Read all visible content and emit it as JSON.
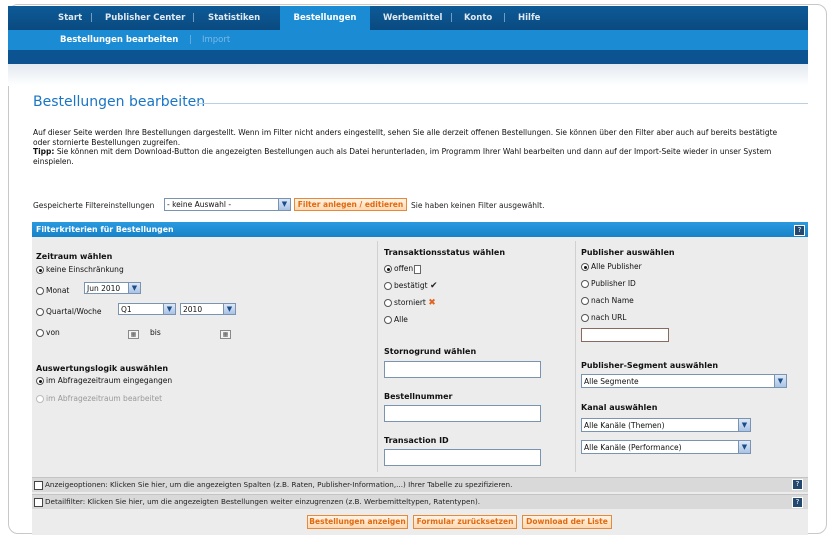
{
  "nav": {
    "items": [
      "Start",
      "Publisher Center",
      "Statistiken",
      "Bestellungen",
      "Werbemittel",
      "Konto",
      "Hilfe"
    ],
    "separator": "|",
    "sub_active": "Bestellungen bearbeiten",
    "sub_separator": "|",
    "sub_inactive": "Import"
  },
  "page": {
    "title": "Bestellungen bearbeiten",
    "intro_line1": "Auf dieser Seite werden Ihre Bestellungen dargestellt. Wenn im Filter nicht anders eingestellt, sehen Sie alle derzeit offenen Bestellungen. Sie können über den Filter aber auch auf bereits bestätigte oder stornierte Bestellungen zugreifen.",
    "tip_label": "Tipp:",
    "tip_text": " Sie können mit dem Download-Button die angezeigten Bestellungen auch als Datei herunterladen, im Programm Ihrer Wahl bearbeiten und dann auf der Import-Seite wieder in unser System einspielen."
  },
  "saved_filters": {
    "label": "Gespeicherte Filtereinstellungen",
    "selected": "- keine Auswahl -",
    "button": "Filter anlegen / editieren",
    "status": "Sie haben keinen Filter ausgewählt."
  },
  "filter": {
    "header": "Filterkriterien für Bestellungen",
    "help": "?",
    "period": {
      "title": "Zeitraum wählen",
      "opt_none": "keine Einschränkung",
      "opt_month": "Monat",
      "month_value": "Jun 2010",
      "opt_quarter": "Quartal/Woche",
      "quarter_value": "Q1",
      "year_value": "2010",
      "opt_from": "von",
      "to_label": "bis"
    },
    "logic": {
      "title": "Auswertungslogik auswählen",
      "opt_received": "im Abfragezeitraum eingegangen",
      "opt_processed": "im Abfragezeitraum bearbeitet"
    },
    "status": {
      "title": "Transaktionsstatus wählen",
      "opt_open": "offen",
      "opt_confirmed": "bestätigt",
      "opt_cancelled": "storniert",
      "opt_all": "Alle"
    },
    "cancel_reason_title": "Stornogrund wählen",
    "order_number_title": "Bestellnummer",
    "transaction_id_title": "Transaction ID",
    "publisher": {
      "title": "Publisher auswählen",
      "opt_all": "Alle Publisher",
      "opt_id": "Publisher ID",
      "opt_name": "nach Name",
      "opt_url": "nach URL"
    },
    "segment": {
      "title": "Publisher-Segment auswählen",
      "selected": "Alle Segmente"
    },
    "channel": {
      "title": "Kanal auswählen",
      "themes": "Alle Kanäle (Themen)",
      "performance": "Alle Kanäle (Performance)"
    }
  },
  "display_options": "Anzeigeoptionen: Klicken Sie hier, um die angezeigten Spalten (z.B. Raten, Publisher-Information,...) Ihrer Tabelle zu spezifizieren.",
  "detail_filter": "Detailfilter: Klicken Sie hier, um die angezeigten Bestellungen weiter einzugrenzen (z.B. Werbemitteltypen, Ratentypen).",
  "buttons": {
    "show": "Bestellungen anzeigen",
    "reset": "Formular zurücksetzen",
    "download": "Download der Liste"
  },
  "icons": {
    "dropdown": "chevron-down-icon",
    "calendar": "calendar-icon",
    "help": "help-icon",
    "document": "document-icon",
    "check": "check-icon",
    "cross": "cross-icon"
  },
  "colors": {
    "nav_dark": "#0a4e86",
    "nav_active": "#1b8cd4",
    "title_blue": "#1975c6",
    "button_orange": "#e06a10",
    "panel_head": "#1782c8"
  }
}
